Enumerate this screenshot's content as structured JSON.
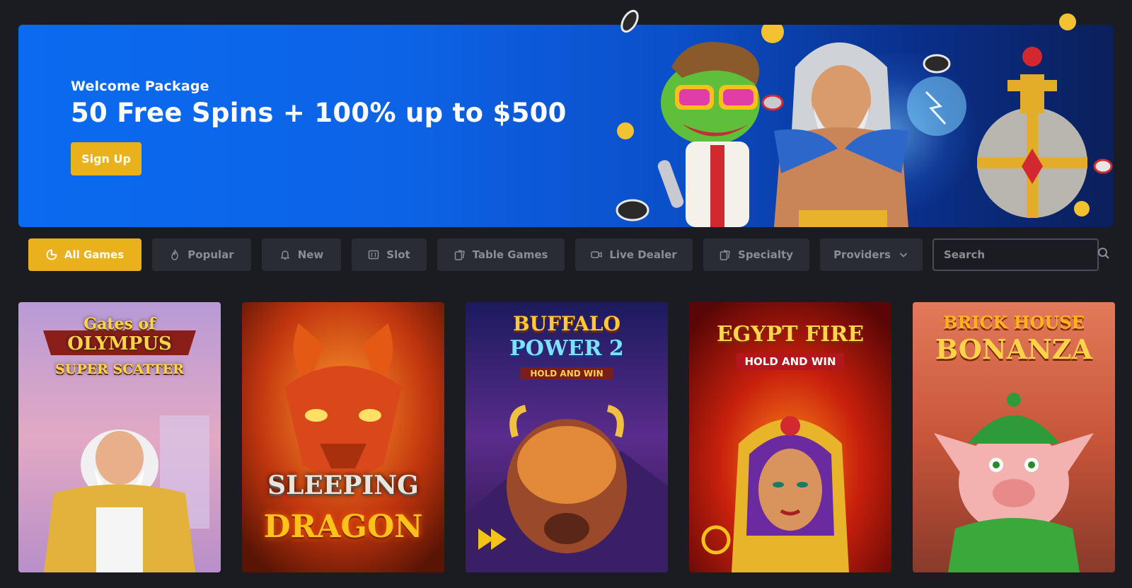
{
  "hero": {
    "subtitle": "Welcome Package",
    "title": "50 Free Spins + 100% up to $500",
    "cta_label": "Sign Up"
  },
  "filters": {
    "tabs": [
      {
        "label": "All Games",
        "icon": "all-games-icon",
        "active": true
      },
      {
        "label": "Popular",
        "icon": "flame-icon",
        "active": false
      },
      {
        "label": "New",
        "icon": "bell-icon",
        "active": false
      },
      {
        "label": "Slot",
        "icon": "slot-machine-icon",
        "active": false
      },
      {
        "label": "Table Games",
        "icon": "cards-icon",
        "active": false
      },
      {
        "label": "Live Dealer",
        "icon": "video-camera-icon",
        "active": false
      },
      {
        "label": "Specialty",
        "icon": "cards-icon",
        "active": false
      }
    ],
    "providers_label": "Providers",
    "search_placeholder": "Search"
  },
  "games": [
    {
      "title_line1": "Gates of",
      "title_line2": "OLYMPUS",
      "title_line3": "SUPER SCATTER"
    },
    {
      "title_line1": "SLEEPING",
      "title_line2": "DRAGON",
      "title_line3": ""
    },
    {
      "title_line1": "BUFFALO",
      "title_line2": "POWER 2",
      "title_line3": "HOLD AND WIN"
    },
    {
      "title_line1": "EGYPT FIRE",
      "title_line2": "HOLD AND WIN",
      "title_line3": ""
    },
    {
      "title_line1": "BRICK HOUSE",
      "title_line2": "BONANZA",
      "title_line3": ""
    }
  ],
  "colors": {
    "page_bg": "#1b1c21",
    "accent": "#e9b21c",
    "chip_bg": "#2a2c33",
    "chip_text": "#8a8d96",
    "hero_blue": "#0a6bf0"
  }
}
